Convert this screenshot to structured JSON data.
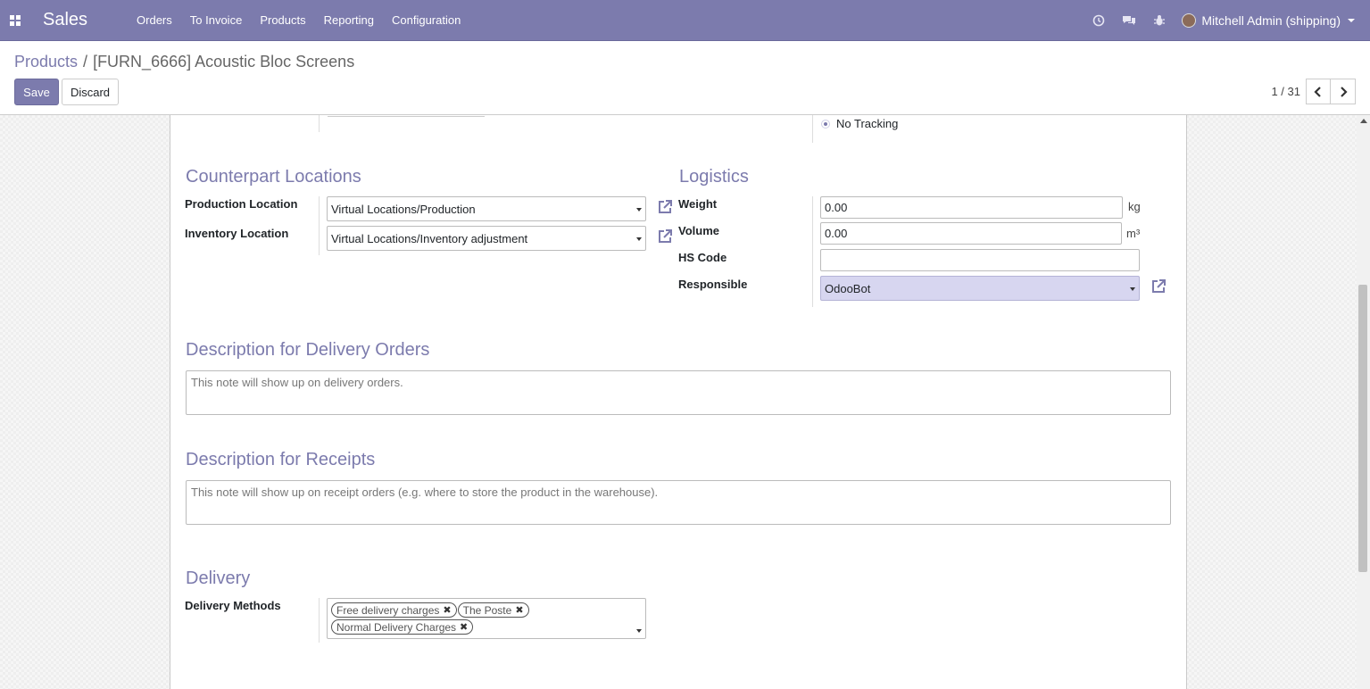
{
  "navbar": {
    "app_name": "Sales",
    "menu": [
      "Orders",
      "To Invoice",
      "Products",
      "Reporting",
      "Configuration"
    ],
    "user": "Mitchell Admin (shipping)",
    "icons": [
      "apps-grid-icon",
      "clock-icon",
      "chat-icon",
      "bug-icon"
    ]
  },
  "breadcrumb": {
    "parent": "Products",
    "separator": "/",
    "current": "[FURN_6666] Acoustic Bloc Screens"
  },
  "buttons": {
    "save": "Save",
    "discard": "Discard"
  },
  "pager": {
    "value": "1 / 31"
  },
  "tracking": {
    "selected": "No Tracking"
  },
  "counterpart": {
    "title": "Counterpart Locations",
    "production_label": "Production Location",
    "production_value": "Virtual Locations/Production",
    "inventory_label": "Inventory Location",
    "inventory_value": "Virtual Locations/Inventory adjustment"
  },
  "logistics": {
    "title": "Logistics",
    "weight_label": "Weight",
    "weight_value": "0.00",
    "weight_unit": "kg",
    "volume_label": "Volume",
    "volume_value": "0.00",
    "volume_unit": "m³",
    "hs_label": "HS Code",
    "hs_value": "",
    "responsible_label": "Responsible",
    "responsible_value": "OdooBot"
  },
  "delivery_desc": {
    "title": "Description for Delivery Orders",
    "placeholder": "This note will show up on delivery orders."
  },
  "receipt_desc": {
    "title": "Description for Receipts",
    "placeholder": "This note will show up on receipt orders (e.g. where to store the product in the warehouse)."
  },
  "delivery": {
    "title": "Delivery",
    "methods_label": "Delivery Methods",
    "methods": [
      "Free delivery charges",
      "The Poste",
      "Normal Delivery Charges"
    ]
  },
  "colors": {
    "brand": "#7c7bad",
    "selected_field": "#d7d6f0"
  }
}
